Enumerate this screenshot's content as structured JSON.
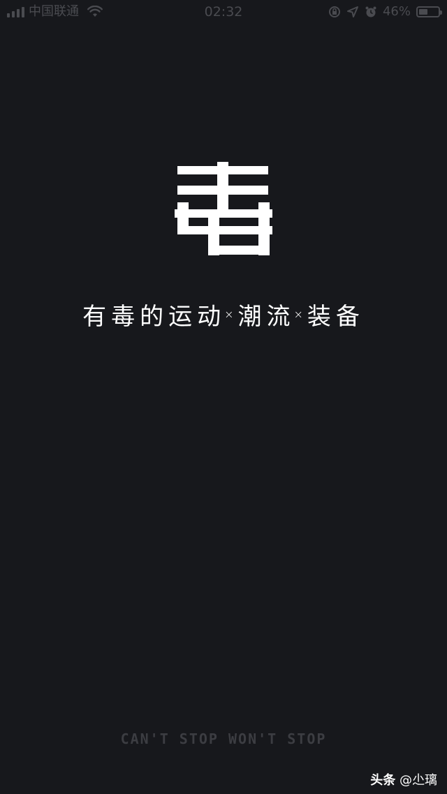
{
  "status_bar": {
    "carrier": "中国联通",
    "time": "02:32",
    "battery_percent": "46%",
    "battery_level": 0.46,
    "icons": [
      "signal-icon",
      "wifi-icon",
      "orientation-lock-icon",
      "location-icon",
      "alarm-icon",
      "battery-icon"
    ]
  },
  "splash": {
    "logo_text": "毒",
    "tagline_parts": [
      "有毒的运动",
      "潮流",
      "装备"
    ],
    "separator": "×",
    "slogan": "CAN'T STOP WON'T STOP"
  },
  "watermark": {
    "brand": "头条",
    "handle": "@尐璃"
  },
  "colors": {
    "background": "#17181c",
    "logo": "#ffffff",
    "slogan": "#3c3d42",
    "status_bar": "#4a4b50"
  }
}
